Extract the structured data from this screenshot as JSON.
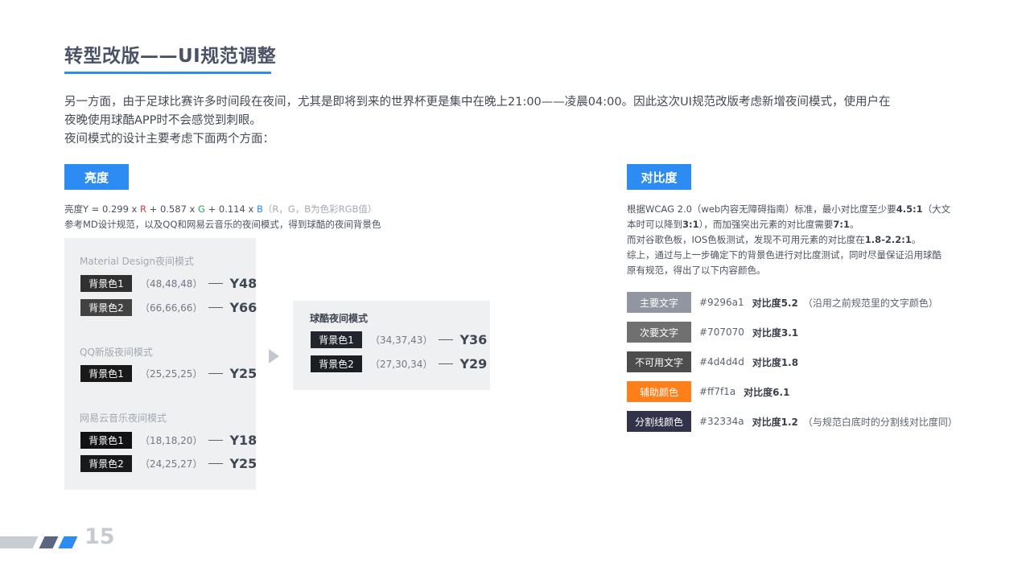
{
  "title": "转型改版——UI规范调整",
  "intro": [
    "另一方面，由于足球比赛许多时间段在夜间，尤其是即将到来的世界杯更是集中在晚上21:00——凌晨04:00。因此这次UI规范改版考虑新增夜间模式，使用户在",
    "夜晚使用球酷APP时不会感觉到刺眼。",
    "夜间模式的设计主要考虑下面两个方面："
  ],
  "brightness": {
    "tag": "亮度",
    "formula": {
      "prefix": "亮度Y = 0.299 x ",
      "r": "R",
      "mid1": " +  0.587 x ",
      "g": "G",
      "mid2": "  + 0.114 x ",
      "b": "B",
      "note": "（R，G，B为色彩RGB值）"
    },
    "reference": "参考MD设计规范，以及QQ和网易云音乐的夜间模式，得到球酷的夜间背景色",
    "groups": [
      {
        "title": "Material Design夜间模式",
        "rows": [
          {
            "label": "背景色1",
            "rgb": "（48,48,48）",
            "y": "Y48",
            "color": "#303030"
          },
          {
            "label": "背景色2",
            "rgb": "（66,66,66）",
            "y": "Y66",
            "color": "#424242"
          }
        ]
      },
      {
        "title": "QQ新版夜间模式",
        "rows": [
          {
            "label": "背景色1",
            "rgb": "（25,25,25）",
            "y": "Y25",
            "color": "#191919"
          }
        ]
      },
      {
        "title": "网易云音乐夜间模式",
        "rows": [
          {
            "label": "背景色1",
            "rgb": "（18,18,20）",
            "y": "Y18",
            "color": "#121214"
          },
          {
            "label": "背景色2",
            "rgb": "（24,25,27）",
            "y": "Y25",
            "color": "#18191b"
          }
        ]
      }
    ],
    "result": {
      "title": "球酷夜间模式",
      "rows": [
        {
          "label": "背景色1",
          "rgb": "（34,37,43）",
          "y": "Y36",
          "color": "#22252b"
        },
        {
          "label": "背景色2",
          "rgb": "（27,30,34）",
          "y": "Y29",
          "color": "#1b1e22"
        }
      ]
    }
  },
  "contrast": {
    "tag": "对比度",
    "para": {
      "l1a": "根据WCAG 2.0（web内容无障碍指南）标准，最小对比度至少要",
      "l1b": "4.5:1",
      "l1c": "（大文",
      "l2a": "本时可以降到",
      "l2b": "3:1",
      "l2c": "），而加强突出元素的对比度需要",
      "l2d": "7:1",
      "l2e": "。",
      "l3a": "而对谷歌色板，IOS色板测试，发现不可用元素的对比度在",
      "l3b": "1.8-2.2:1",
      "l3c": "。",
      "l4": "综上，通过与上一步确定下的背景色进行对比度测试，同时尽量保证沿用球酷",
      "l5": "原有规范，得出了以下内容颜色。"
    },
    "colors": [
      {
        "label": "主要文字",
        "hex": "#9296a1",
        "ratio": "对比度5.2",
        "note": "（沿用之前规范里的文字颜色）",
        "color": "#9296a1"
      },
      {
        "label": "次要文字",
        "hex": "#707070",
        "ratio": "对比度3.1",
        "note": "",
        "color": "#707070"
      },
      {
        "label": "不可用文字",
        "hex": "#4d4d4d",
        "ratio": "对比度1.8",
        "note": "",
        "color": "#4d4d4d"
      },
      {
        "label": "辅助颜色",
        "hex": "#ff7f1a",
        "ratio": "对比度6.1",
        "note": "",
        "color": "#ff7f1a"
      },
      {
        "label": "分割线颜色",
        "hex": "#32334a",
        "ratio": "对比度1.2",
        "note": "（与规范白底时的分割线对比度同）",
        "color": "#32334a"
      }
    ]
  },
  "footer": {
    "page": "15",
    "bar_colors": [
      "#c8ccd3",
      "#5b6680",
      "#2c8cf4"
    ]
  }
}
